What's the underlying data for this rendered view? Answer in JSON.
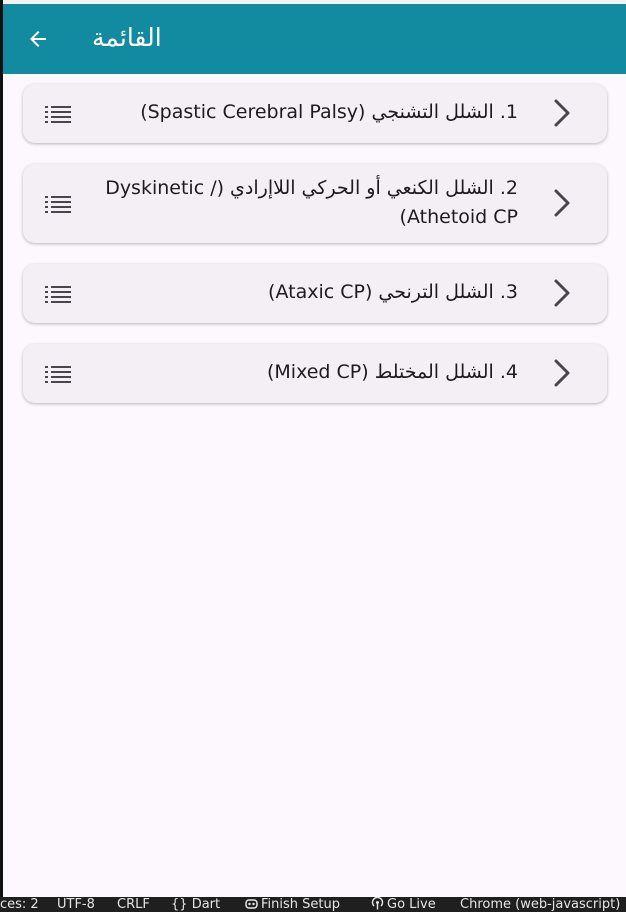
{
  "appbar": {
    "title": "القائمة",
    "bg_color": "#128aa0",
    "back_icon": "arrow-back-icon"
  },
  "list": {
    "leading_icon": "list-icon",
    "trailing_icon": "chevron-right-icon",
    "items": [
      {
        "label": "1. الشلل التشنجي (Spastic Cerebral Palsy)"
      },
      {
        "label": "2. الشلل الكنعي أو الحركي اللاإرادي (Dyskinetic / Athetoid CP)"
      },
      {
        "label": "3. الشلل الترنحي (Ataxic CP)"
      },
      {
        "label": "4. الشلل المختلط (Mixed CP)"
      }
    ]
  },
  "statusbar": {
    "spaces": "ces: 2",
    "encoding": "UTF-8",
    "line_ending": "CRLF",
    "language": "Dart",
    "finish_setup": "Finish Setup",
    "go_live": "Go Live",
    "debug_target": "Chrome (web-javascript)"
  },
  "colors": {
    "page_bg": "#fdf7fe",
    "card_bg": "#f4eff5",
    "text": "#1d1b20",
    "icon": "#49454f"
  }
}
